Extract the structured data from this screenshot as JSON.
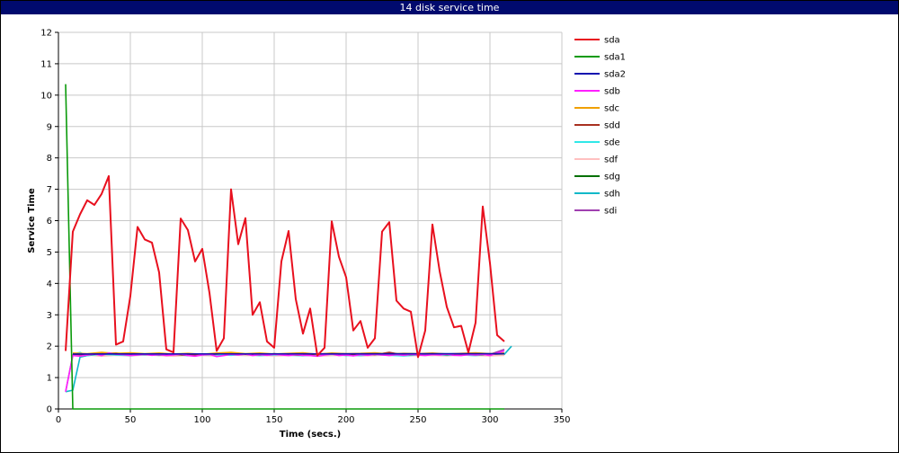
{
  "window": {
    "title": "14 disk service time"
  },
  "chart_data": {
    "type": "line",
    "title": "14 disk service time",
    "xlabel": "Time (secs.)",
    "ylabel": "Service Time",
    "xlim": [
      0,
      350
    ],
    "ylim": [
      0,
      12
    ],
    "xticks": [
      0,
      50,
      100,
      150,
      200,
      250,
      300,
      350
    ],
    "yticks": [
      0,
      1,
      2,
      3,
      4,
      5,
      6,
      7,
      8,
      9,
      10,
      11,
      12
    ],
    "grid": true,
    "legend_position": "right",
    "series": [
      {
        "name": "sda",
        "color": "#e8101e",
        "x": [
          5,
          10,
          15,
          20,
          25,
          30,
          35,
          40,
          45,
          50,
          55,
          60,
          65,
          70,
          75,
          80,
          85,
          90,
          95,
          100,
          105,
          110,
          115,
          120,
          125,
          130,
          135,
          140,
          145,
          150,
          155,
          160,
          165,
          170,
          175,
          180,
          185,
          190,
          195,
          200,
          205,
          210,
          215,
          220,
          225,
          230,
          235,
          240,
          245,
          250,
          255,
          260,
          265,
          270,
          275,
          280,
          285,
          290,
          295,
          300,
          305,
          310
        ],
        "y": [
          1.85,
          5.65,
          6.2,
          6.65,
          6.5,
          6.85,
          7.42,
          2.05,
          2.15,
          3.6,
          5.8,
          5.4,
          5.3,
          4.35,
          1.9,
          1.8,
          6.07,
          5.7,
          4.7,
          5.1,
          3.7,
          1.85,
          2.25,
          7.0,
          5.25,
          6.08,
          3.0,
          3.4,
          2.15,
          1.95,
          4.7,
          5.67,
          3.5,
          2.4,
          3.2,
          1.7,
          1.95,
          5.98,
          4.85,
          4.2,
          2.5,
          2.8,
          1.95,
          2.25,
          5.65,
          5.95,
          3.45,
          3.2,
          3.1,
          1.65,
          2.5,
          5.88,
          4.4,
          3.25,
          2.6,
          2.65,
          1.8,
          2.75,
          6.45,
          4.65,
          2.35,
          2.15
        ]
      },
      {
        "name": "sda1",
        "color": "#0a9a0a",
        "x": [
          5,
          10,
          310
        ],
        "y": [
          10.35,
          0.0,
          0.0
        ]
      },
      {
        "name": "sda2",
        "color": "#1010b0",
        "x": [
          10,
          310
        ],
        "y": [
          1.75,
          1.76
        ]
      },
      {
        "name": "sdb",
        "color": "#ff20ff",
        "x": [
          5,
          10,
          15,
          20,
          25,
          30,
          35,
          40,
          45,
          50,
          55,
          60,
          65,
          70,
          75,
          80,
          85,
          90,
          95,
          100,
          105,
          110,
          115,
          120,
          125,
          130,
          135,
          140,
          145,
          150,
          155,
          160,
          165,
          170,
          175,
          180,
          185,
          190,
          195,
          200,
          205,
          210,
          215,
          220,
          225,
          230,
          235,
          240,
          245,
          250,
          255,
          260,
          265,
          270,
          275,
          280,
          285,
          290,
          295,
          300,
          305,
          310
        ],
        "y": [
          0.55,
          1.7,
          1.68,
          1.72,
          1.75,
          1.7,
          1.78,
          1.74,
          1.73,
          1.7,
          1.72,
          1.74,
          1.71,
          1.73,
          1.7,
          1.72,
          1.75,
          1.7,
          1.68,
          1.72,
          1.74,
          1.67,
          1.7,
          1.74,
          1.72,
          1.75,
          1.7,
          1.73,
          1.71,
          1.74,
          1.72,
          1.7,
          1.73,
          1.71,
          1.7,
          1.68,
          1.72,
          1.75,
          1.7,
          1.72,
          1.69,
          1.73,
          1.71,
          1.74,
          1.72,
          1.7,
          1.73,
          1.71,
          1.74,
          1.72,
          1.7,
          1.73,
          1.72,
          1.75,
          1.71,
          1.7,
          1.73,
          1.72,
          1.74,
          1.7,
          1.78,
          1.85
        ]
      },
      {
        "name": "sdc",
        "color": "#f0a000",
        "x": [
          10,
          20,
          30,
          40,
          50,
          60,
          70,
          80,
          90,
          100,
          110,
          120,
          130,
          140,
          150,
          160,
          170,
          180,
          190,
          200,
          210,
          220,
          230,
          240,
          250,
          260,
          270,
          280,
          290,
          300,
          310
        ],
        "y": [
          1.78,
          1.76,
          1.8,
          1.77,
          1.79,
          1.76,
          1.78,
          1.75,
          1.77,
          1.74,
          1.78,
          1.8,
          1.76,
          1.78,
          1.75,
          1.77,
          1.79,
          1.74,
          1.78,
          1.76,
          1.77,
          1.79,
          1.75,
          1.77,
          1.76,
          1.78,
          1.75,
          1.77,
          1.79,
          1.76,
          1.78
        ]
      },
      {
        "name": "sdd",
        "color": "#a83020",
        "x": [
          10,
          20,
          30,
          40,
          50,
          60,
          70,
          80,
          90,
          100,
          110,
          120,
          130,
          140,
          150,
          160,
          170,
          180,
          190,
          200,
          210,
          220,
          230,
          240,
          250,
          260,
          270,
          280,
          290,
          300,
          310
        ],
        "y": [
          1.74,
          1.72,
          1.76,
          1.78,
          1.73,
          1.75,
          1.72,
          1.74,
          1.71,
          1.73,
          1.75,
          1.78,
          1.74,
          1.72,
          1.76,
          1.73,
          1.71,
          1.74,
          1.77,
          1.72,
          1.75,
          1.73,
          1.8,
          1.72,
          1.74,
          1.76,
          1.73,
          1.75,
          1.72,
          1.74,
          1.76
        ]
      },
      {
        "name": "sde",
        "color": "#30e8e8",
        "x": [
          10,
          15,
          20,
          30,
          40,
          50,
          60,
          70,
          80,
          90,
          100,
          110,
          120,
          130,
          140,
          150,
          160,
          170,
          180,
          190,
          200,
          210,
          220,
          230,
          240,
          250,
          260,
          270,
          280,
          290,
          300,
          310
        ],
        "y": [
          1.75,
          1.8,
          1.7,
          1.74,
          1.72,
          1.7,
          1.73,
          1.71,
          1.74,
          1.7,
          1.72,
          1.73,
          1.71,
          1.74,
          1.7,
          1.72,
          1.73,
          1.7,
          1.72,
          1.74,
          1.71,
          1.7,
          1.73,
          1.71,
          1.69,
          1.72,
          1.74,
          1.71,
          1.73,
          1.7,
          1.74,
          1.78
        ]
      },
      {
        "name": "sdf",
        "color": "#ffc0c0",
        "x": [
          10,
          20,
          30,
          40,
          50,
          60,
          70,
          80,
          90,
          100,
          110,
          120,
          130,
          140,
          150,
          160,
          170,
          180,
          190,
          200,
          210,
          220,
          230,
          240,
          250,
          260,
          270,
          280,
          290,
          300,
          310
        ],
        "y": [
          1.7,
          1.72,
          1.68,
          1.71,
          1.69,
          1.72,
          1.7,
          1.68,
          1.71,
          1.7,
          1.69,
          1.72,
          1.7,
          1.71,
          1.69,
          1.7,
          1.72,
          1.68,
          1.7,
          1.71,
          1.69,
          1.7,
          1.72,
          1.69,
          1.7,
          1.71,
          1.69,
          1.72,
          1.7,
          1.69,
          1.71
        ]
      },
      {
        "name": "sdg",
        "color": "#007000",
        "x": [
          10,
          20,
          30,
          40,
          50,
          60,
          70,
          80,
          90,
          100,
          110,
          120,
          130,
          140,
          150,
          160,
          170,
          180,
          190,
          200,
          210,
          220,
          230,
          240,
          250,
          260,
          270,
          280,
          290,
          300,
          310
        ],
        "y": [
          1.72,
          1.75,
          1.73,
          1.77,
          1.74,
          1.72,
          1.75,
          1.73,
          1.71,
          1.74,
          1.72,
          1.76,
          1.74,
          1.72,
          1.75,
          1.73,
          1.71,
          1.74,
          1.76,
          1.73,
          1.72,
          1.75,
          1.78,
          1.73,
          1.72,
          1.75,
          1.73,
          1.74,
          1.72,
          1.75,
          1.77
        ]
      },
      {
        "name": "sdh",
        "color": "#10b8c8",
        "x": [
          5,
          10,
          15,
          20,
          30,
          40,
          50,
          60,
          70,
          80,
          90,
          100,
          110,
          120,
          130,
          140,
          150,
          160,
          170,
          180,
          190,
          200,
          210,
          220,
          230,
          240,
          250,
          260,
          270,
          280,
          290,
          300,
          310,
          315
        ],
        "y": [
          0.55,
          0.6,
          1.65,
          1.7,
          1.74,
          1.72,
          1.7,
          1.73,
          1.71,
          1.72,
          1.7,
          1.72,
          1.71,
          1.73,
          1.72,
          1.7,
          1.73,
          1.71,
          1.7,
          1.72,
          1.74,
          1.7,
          1.72,
          1.71,
          1.73,
          1.7,
          1.72,
          1.71,
          1.73,
          1.72,
          1.7,
          1.75,
          1.74,
          2.0
        ]
      },
      {
        "name": "sdi",
        "color": "#a040b0",
        "x": [
          5,
          10,
          20,
          30,
          40,
          50,
          60,
          70,
          80,
          90,
          100,
          110,
          120,
          130,
          140,
          150,
          160,
          170,
          180,
          190,
          200,
          210,
          220,
          230,
          240,
          250,
          260,
          270,
          280,
          290,
          300,
          310
        ],
        "y": [
          0.55,
          1.72,
          1.74,
          1.76,
          1.73,
          1.75,
          1.72,
          1.74,
          1.71,
          1.73,
          1.72,
          1.75,
          1.78,
          1.74,
          1.72,
          1.75,
          1.73,
          1.71,
          1.73,
          1.76,
          1.72,
          1.74,
          1.72,
          1.75,
          1.73,
          1.72,
          1.74,
          1.73,
          1.75,
          1.72,
          1.74,
          1.9
        ]
      }
    ]
  }
}
